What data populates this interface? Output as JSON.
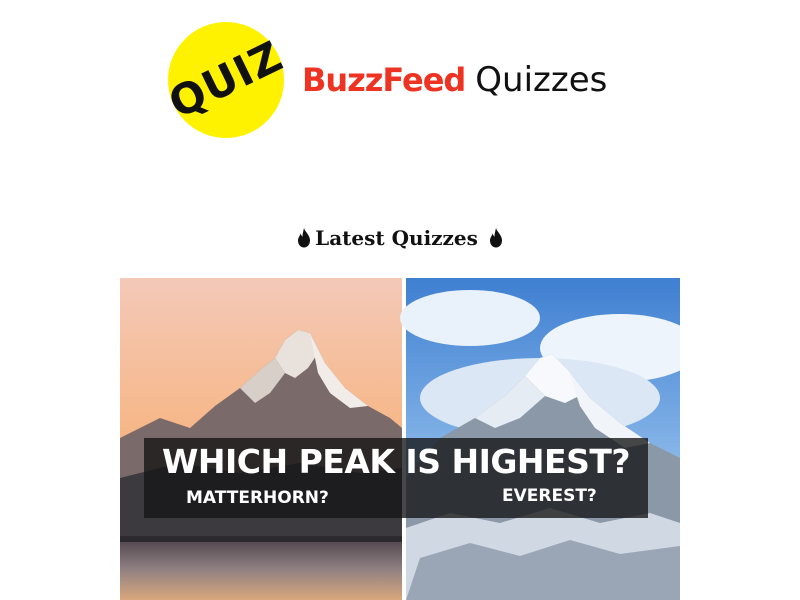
{
  "header": {
    "badge_text": "QUIZ",
    "brand_name": "BuzzFeed",
    "brand_suffix": "Quizzes"
  },
  "section": {
    "heading": "Latest Quizzes",
    "icon": "fire-icon"
  },
  "quiz_card": {
    "title": "WHICH PEAK IS HIGHEST?",
    "option_left": "MATTERHORN?",
    "option_right": "EVEREST?"
  },
  "colors": {
    "badge_yellow": "#fff200",
    "brand_red": "#ee3322",
    "text_dark": "#111111"
  }
}
